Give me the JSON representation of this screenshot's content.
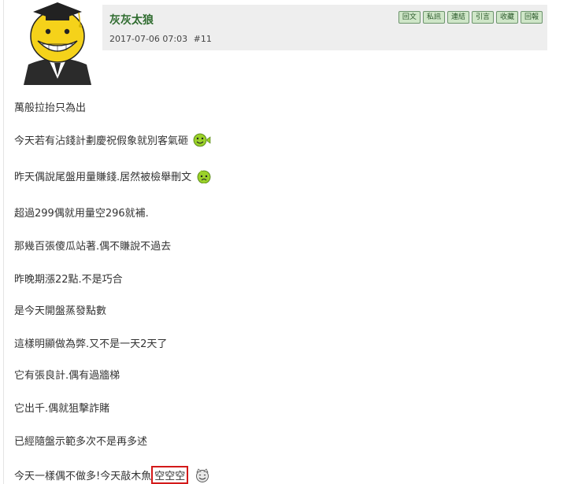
{
  "post": {
    "author": "灰灰太狼",
    "datetime": "2017-07-06 07:03",
    "floor": "#11"
  },
  "actions": [
    "回文",
    "私訊",
    "連結",
    "引言",
    "收藏",
    "回報"
  ],
  "lines": [
    "萬般拉抬只為出",
    "今天若有沾錢計劃慶祝假象就別客氣砸",
    "昨天偶說尾盤用量賺錢.居然被檢舉刪文",
    "超過299偶就用量空296就補.",
    "那幾百張傻瓜站著.偶不賺說不過去",
    "昨晚期漲22點.不是巧合",
    "是今天開盤蒸發點數",
    "這樣明顯做為弊.又不是一天2天了",
    "它有張良計.偶有過牆梯",
    "它出千.偶就狙擊詐賭",
    "已經隨盤示範多次不是再多述"
  ],
  "last_line": {
    "text": "今天一樣偶不做多!今天敲木魚",
    "highlight": "空空空"
  },
  "colors": {
    "header_bg": "#eeeeee",
    "author": "#2e6b2e",
    "button_bg": "#cfe6c8",
    "highlight_border": "#d31919"
  }
}
